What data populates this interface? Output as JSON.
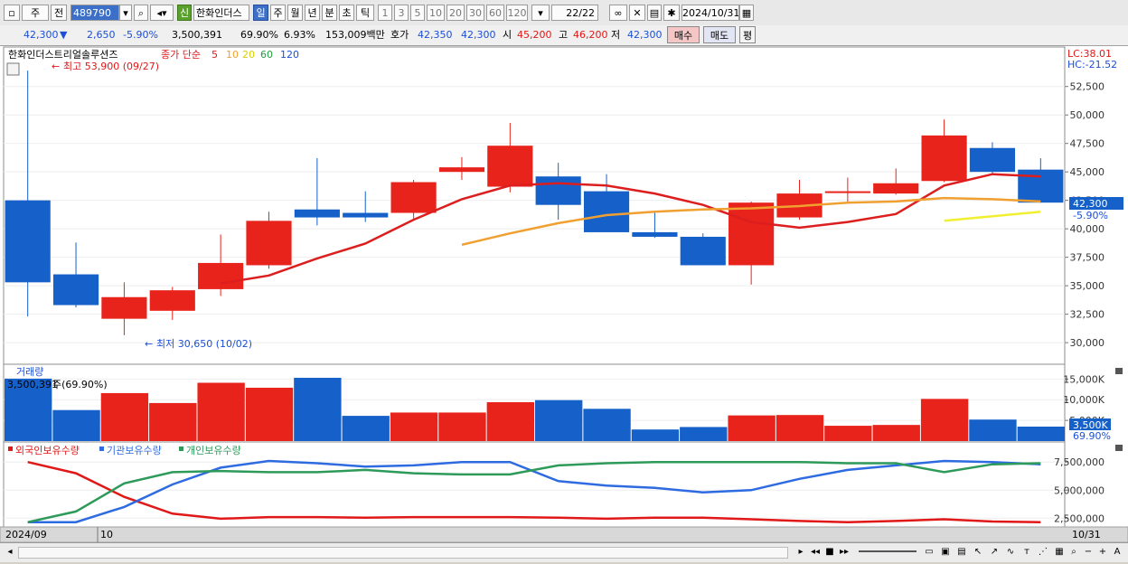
{
  "toolbar": {
    "market_type": "주",
    "prev_label": "전",
    "stock_code": "489790",
    "credit_badge": "신",
    "stock_name": "한화인더스",
    "period_tabs": [
      "일",
      "주",
      "월",
      "년",
      "분",
      "초",
      "틱"
    ],
    "active_period": "일",
    "intervals": [
      "1",
      "3",
      "5",
      "10",
      "20",
      "30",
      "60",
      "120"
    ],
    "count": "22/22",
    "date": "2024/10/31"
  },
  "quote": {
    "price": "42,300",
    "direction": "▼",
    "change": "2,650",
    "change_pct": "-5.90%",
    "volume": "3,500,391",
    "volume_ratio": "69.90%",
    "turnover": "6.93%",
    "trade_value": "153,009백만",
    "bid_ask_label": "호가",
    "bid_ask_1": "42,350",
    "bid_ask_2": "42,300",
    "open_label": "시",
    "open": "45,200",
    "high_label": "고",
    "high": "46,200",
    "low_label": "저",
    "low": "42,300",
    "buy_button": "매수",
    "sell_button": "매도",
    "eval_button": "평"
  },
  "colors": {
    "up": "#e8231b",
    "down": "#1560c9",
    "ma5": "#dc1e1e",
    "ma10": "#f0a030",
    "ma20": "#f0f030",
    "foreign": "#e01818",
    "institution": "#2e6be0",
    "individual": "#2e9a5a"
  },
  "price_panel": {
    "stock_label": "한화인더스트리얼솔루션즈",
    "ma_label": "종가 단순",
    "ma_periods": [
      "5",
      "10",
      "20",
      "60",
      "120"
    ],
    "max_label": "최고 53,900 (09/27)",
    "min_label": "최저 30,650 (10/02)",
    "lc_label": "LC:38.01",
    "hc_label": "HC:-21.52",
    "current_price_tag": "42,300",
    "current_pct_tag": "-5.90%"
  },
  "volume_panel": {
    "title": "거래량",
    "value_label": "3,500,391",
    "unit_label": "주(69.90%)",
    "current_tag": "3,500K",
    "ratio_tag": "69.90%"
  },
  "holdings_panel": {
    "legend": [
      "외국인보유수량",
      "기관보유수량",
      "개인보유수량"
    ]
  },
  "x_axis": {
    "labels": [
      "2024/09",
      "10"
    ],
    "right_label": "10/31"
  },
  "chart_data": [
    {
      "type": "candlestick",
      "title": "한화인더스트리얼솔루션즈",
      "ylim": [
        28500,
        54700
      ],
      "y_ticks": [
        30000,
        32500,
        35000,
        37500,
        40000,
        42500,
        45000,
        47500,
        50000,
        52500
      ],
      "y_tick_labels": [
        "30,000",
        "32,500",
        "35,000",
        "37,500",
        "40,000",
        "42,500",
        "45,000",
        "47,500",
        "50,000",
        "52,500"
      ],
      "candles": [
        {
          "open": 42500,
          "high": 53900,
          "low": 32300,
          "close": 35300
        },
        {
          "open": 36000,
          "high": 38800,
          "low": 33100,
          "close": 33300
        },
        {
          "open": 32100,
          "high": 35300,
          "low": 30650,
          "close": 34000
        },
        {
          "open": 32800,
          "high": 34900,
          "low": 32000,
          "close": 34600
        },
        {
          "open": 34700,
          "high": 39500,
          "low": 34100,
          "close": 37000
        },
        {
          "open": 36800,
          "high": 41500,
          "low": 36500,
          "close": 40700
        },
        {
          "open": 41700,
          "high": 46200,
          "low": 40300,
          "close": 41000
        },
        {
          "open": 41400,
          "high": 43300,
          "low": 40600,
          "close": 41000
        },
        {
          "open": 41400,
          "high": 44300,
          "low": 40900,
          "close": 44100
        },
        {
          "open": 45000,
          "high": 46300,
          "low": 44300,
          "close": 45400
        },
        {
          "open": 43700,
          "high": 49300,
          "low": 43200,
          "close": 47300
        },
        {
          "open": 44600,
          "high": 45800,
          "low": 40800,
          "close": 42100
        },
        {
          "open": 43300,
          "high": 44800,
          "low": 39800,
          "close": 39700
        },
        {
          "open": 39700,
          "high": 41500,
          "low": 39200,
          "close": 39300
        },
        {
          "open": 39300,
          "high": 39600,
          "low": 37200,
          "close": 36800
        },
        {
          "open": 36800,
          "high": 42400,
          "low": 35100,
          "close": 42300
        },
        {
          "open": 41000,
          "high": 44300,
          "low": 40800,
          "close": 43100
        },
        {
          "open": 43200,
          "high": 44500,
          "low": 42400,
          "close": 43300
        },
        {
          "open": 43100,
          "high": 45300,
          "low": 43000,
          "close": 44000
        },
        {
          "open": 44200,
          "high": 49600,
          "low": 44100,
          "close": 48200
        },
        {
          "open": 47100,
          "high": 47600,
          "low": 44800,
          "close": 45000
        },
        {
          "open": 45200,
          "high": 46200,
          "low": 42300,
          "close": 42300
        }
      ],
      "ma5": [
        null,
        null,
        null,
        null,
        35200,
        35900,
        37400,
        38700,
        40800,
        42600,
        43800,
        44000,
        43800,
        43100,
        42100,
        40600,
        40100,
        40600,
        41300,
        43800,
        44800,
        44600
      ],
      "ma10": [
        null,
        null,
        null,
        null,
        null,
        null,
        null,
        null,
        null,
        38600,
        39600,
        40500,
        41200,
        41500,
        41700,
        41800,
        42000,
        42300,
        42400,
        42700,
        42600,
        42400
      ],
      "ma20": [
        null,
        null,
        null,
        null,
        null,
        null,
        null,
        null,
        null,
        null,
        null,
        null,
        null,
        null,
        null,
        null,
        null,
        null,
        null,
        40700,
        41100,
        41500
      ]
    },
    {
      "type": "bar",
      "title": "거래량",
      "ylim": [
        0,
        15300
      ],
      "y_ticks": [
        5000,
        10000,
        15000
      ],
      "y_tick_labels": [
        "5,000K",
        "10,000K",
        "15,000K"
      ],
      "values": [
        15100,
        7500,
        11600,
        9200,
        14100,
        12900,
        15300,
        6100,
        6900,
        6900,
        9400,
        9900,
        7800,
        2800,
        3400,
        6200,
        6300,
        3700,
        3900,
        10200,
        5200,
        3500
      ]
    },
    {
      "type": "line",
      "legend": [
        "외국인보유수량",
        "기관보유수량",
        "개인보유수량"
      ],
      "ylim": [
        1800000,
        8000000
      ],
      "y_ticks": [
        2500000,
        5000000,
        7500000
      ],
      "y_tick_labels": [
        "2,500,000",
        "5,000,000",
        "7,500,000"
      ],
      "series": [
        {
          "name": "외국인보유수량",
          "values": [
            7500000,
            6500000,
            4400000,
            2900000,
            2450000,
            2600000,
            2600000,
            2550000,
            2600000,
            2600000,
            2600000,
            2550000,
            2450000,
            2550000,
            2550000,
            2400000,
            2250000,
            2150000,
            2250000,
            2400000,
            2200000,
            2150000
          ]
        },
        {
          "name": "기관보유수량",
          "values": [
            2150000,
            2150000,
            3500000,
            5500000,
            7000000,
            7600000,
            7400000,
            7100000,
            7200000,
            7500000,
            7500000,
            5800000,
            5400000,
            5200000,
            4800000,
            5000000,
            6000000,
            6800000,
            7200000,
            7600000,
            7500000,
            7300000
          ]
        },
        {
          "name": "개인보유수량",
          "values": [
            2150000,
            3100000,
            5600000,
            6600000,
            6700000,
            6600000,
            6600000,
            6800000,
            6500000,
            6400000,
            6400000,
            7200000,
            7400000,
            7500000,
            7500000,
            7500000,
            7500000,
            7400000,
            7400000,
            6600000,
            7300000,
            7400000
          ]
        }
      ]
    }
  ]
}
